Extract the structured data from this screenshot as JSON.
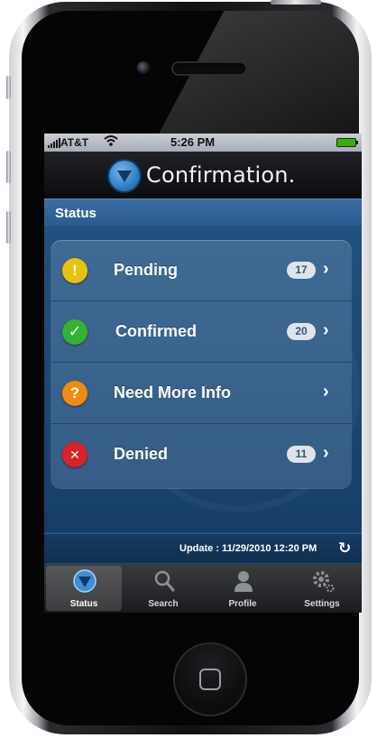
{
  "status_bar": {
    "carrier": "AT&T",
    "time": "5:26 PM"
  },
  "app": {
    "title": "Confirmation."
  },
  "section": {
    "title": "Status"
  },
  "status_list": [
    {
      "label": "Pending",
      "count": "17",
      "icon": "exclamation-icon",
      "icon_symbol": "!",
      "color": "#e8c20c"
    },
    {
      "label": "Confirmed",
      "count": "20",
      "icon": "check-icon",
      "icon_symbol": "✓",
      "color": "#34b233"
    },
    {
      "label": "Need More Info",
      "count": "",
      "icon": "question-icon",
      "icon_symbol": "?",
      "color": "#f08a12"
    },
    {
      "label": "Denied",
      "count": "11",
      "icon": "x-icon",
      "icon_symbol": "✕",
      "color": "#d9222a"
    }
  ],
  "update": {
    "text": "Update : 11/29/2010 12:20 PM"
  },
  "tabs": [
    {
      "label": "Status",
      "icon": "status-icon",
      "active": true
    },
    {
      "label": "Search",
      "icon": "search-icon",
      "active": false
    },
    {
      "label": "Profile",
      "icon": "profile-icon",
      "active": false
    },
    {
      "label": "Settings",
      "icon": "gear-icon",
      "active": false
    }
  ],
  "colors": {
    "primary_blue": "#2a5b8e",
    "list_card": "#3f6a94",
    "badge_text": "#2c5684"
  }
}
